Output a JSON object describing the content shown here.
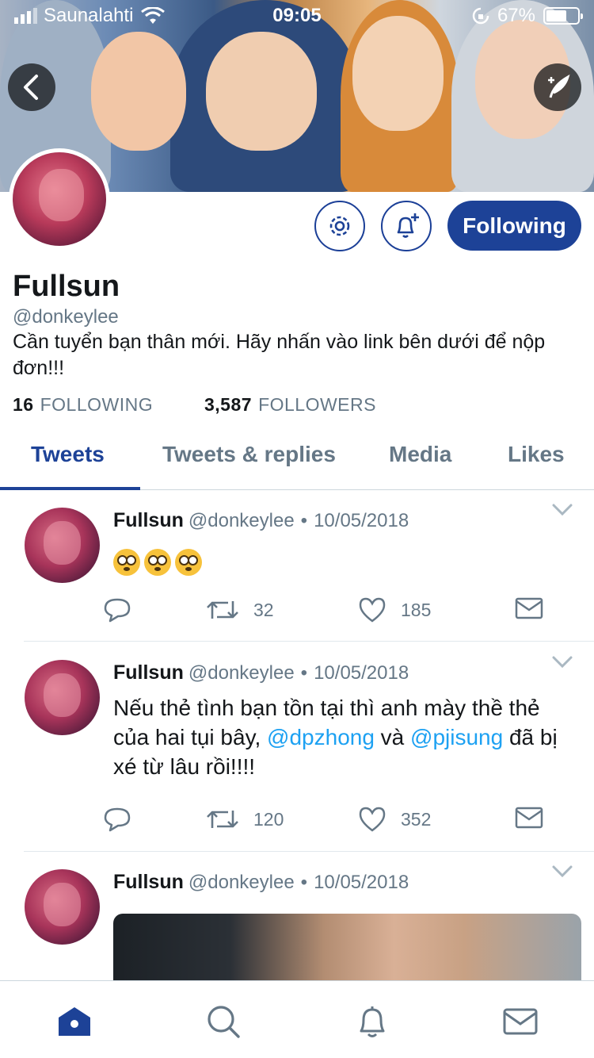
{
  "status_bar": {
    "carrier": "Saunalahti",
    "time": "09:05",
    "battery": "67%",
    "battery_level": 0.67
  },
  "profile": {
    "display_name": "Fullsun",
    "handle": "@donkeylee",
    "bio": "Cần tuyển bạn thân mới. Hãy nhấn vào link bên dưới để nộp đơn!!!",
    "following_count": "16",
    "following_label": "FOLLOWING",
    "followers_count": "3,587",
    "followers_label": "FOLLOWERS",
    "follow_button_label": "Following"
  },
  "tabs": [
    {
      "label": "Tweets",
      "active": true
    },
    {
      "label": "Tweets & replies",
      "active": false
    },
    {
      "label": "Media",
      "active": false
    },
    {
      "label": "Likes",
      "active": false
    }
  ],
  "tweets": [
    {
      "name": "Fullsun",
      "handle": "@donkeylee",
      "separator": "•",
      "date": "10/05/2018",
      "emoji_count": 3,
      "retweets": "32",
      "likes": "185"
    },
    {
      "name": "Fullsun",
      "handle": "@donkeylee",
      "separator": "•",
      "date": "10/05/2018",
      "text_part1": "Nếu thẻ tình bạn tồn tại thì anh mày thề thẻ của hai tụi bây, ",
      "mention1": "@dpzhong",
      "text_part2": " và ",
      "mention2": "@pjisung",
      "text_part3": " đã bị xé từ lâu rồi!!!!",
      "retweets": "120",
      "likes": "352"
    },
    {
      "name": "Fullsun",
      "handle": "@donkeylee",
      "separator": "•",
      "date": "10/05/2018"
    }
  ],
  "colors": {
    "accent": "#1d4297",
    "link": "#1da1f2",
    "muted": "#657786"
  },
  "bottom_nav": [
    "home-icon",
    "search-icon",
    "notifications-icon",
    "messages-icon"
  ]
}
